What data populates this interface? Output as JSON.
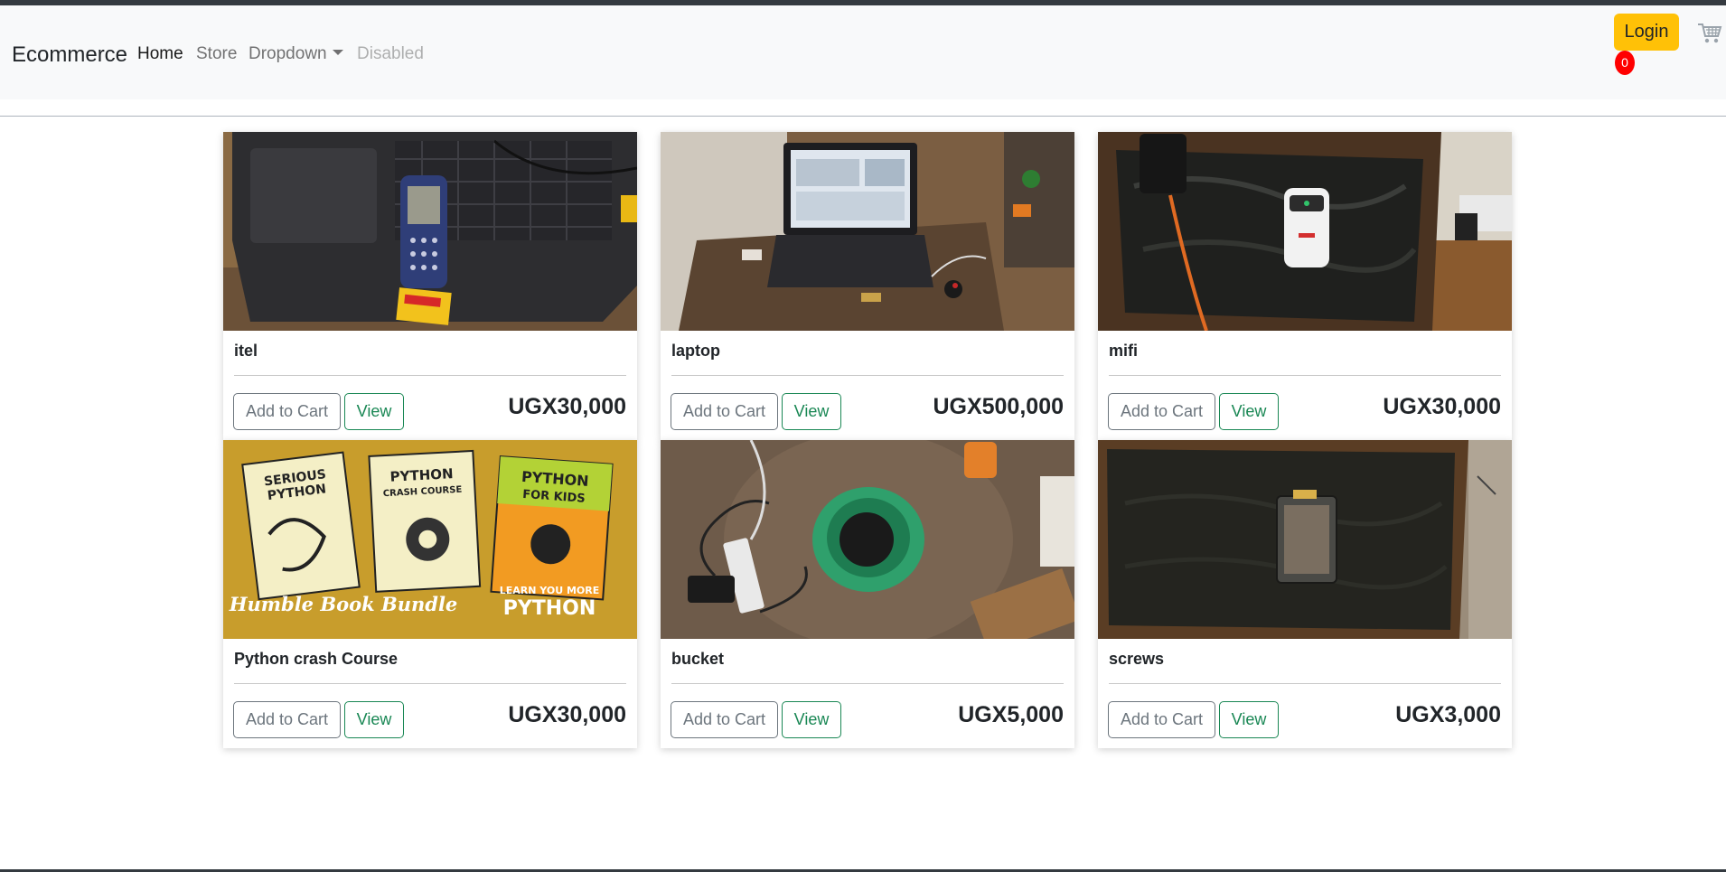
{
  "navbar": {
    "brand": "Ecommerce",
    "links": [
      "Home",
      "Store",
      "Dropdown",
      "Disabled"
    ],
    "login_label": "Login",
    "cart_count": "0",
    "cart_icon": "shopping-cart-icon"
  },
  "products": [
    {
      "name": "itel",
      "price": "UGX30,000",
      "add_label": "Add to Cart",
      "view_label": "View"
    },
    {
      "name": "laptop",
      "price": "UGX500,000",
      "add_label": "Add to Cart",
      "view_label": "View"
    },
    {
      "name": "mifi",
      "price": "UGX30,000",
      "add_label": "Add to Cart",
      "view_label": "View"
    },
    {
      "name": "Python crash Course",
      "price": "UGX30,000",
      "add_label": "Add to Cart",
      "view_label": "View"
    },
    {
      "name": "bucket",
      "price": "UGX5,000",
      "add_label": "Add to Cart",
      "view_label": "View"
    },
    {
      "name": "screws",
      "price": "UGX3,000",
      "add_label": "Add to Cart",
      "view_label": "View"
    }
  ],
  "book_banner": {
    "books": [
      "SERIOUS PYTHON",
      "PYTHON CRASH COURSE",
      "PYTHON FOR KIDS"
    ],
    "bundle": "Humble Book Bundle",
    "tagline_small": "LEARN YOU MORE",
    "tagline_big": "PYTHON"
  },
  "colors": {
    "navbar_bg": "#f8f9fa",
    "login_bg": "#ffc107",
    "badge_bg": "#ff0000",
    "view_border": "#198754"
  }
}
